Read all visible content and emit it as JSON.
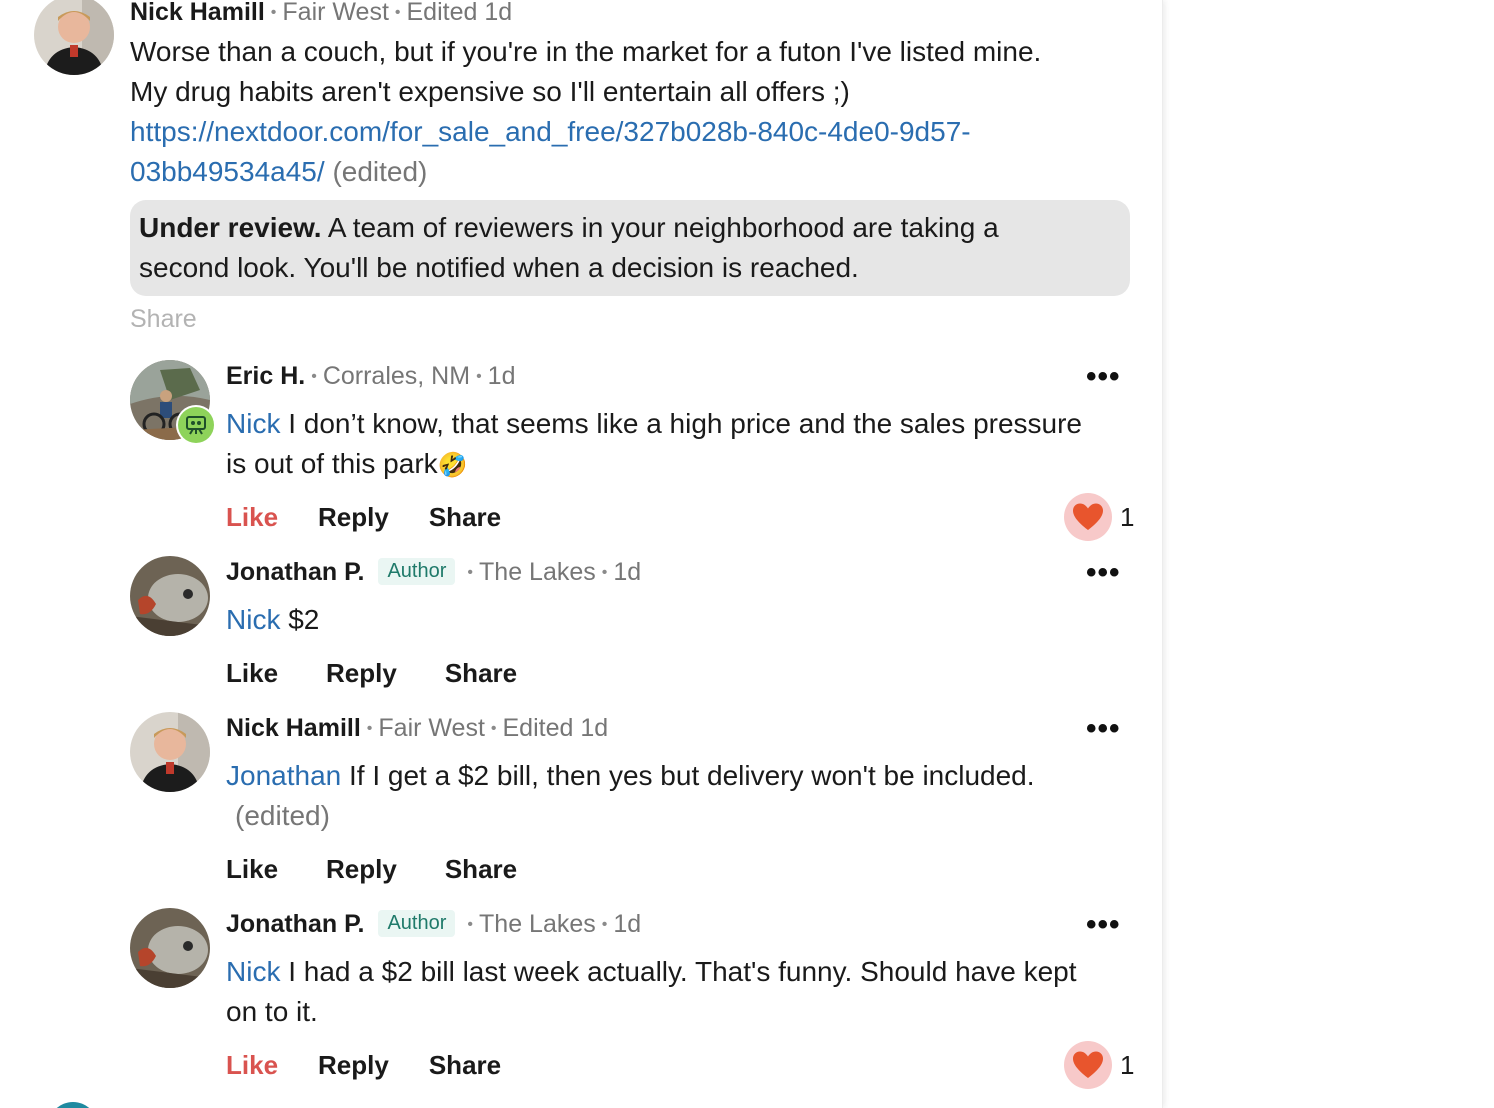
{
  "post": {
    "author": "Nick Hamill",
    "neighborhood": "Fair West",
    "edited_time": "Edited 1d",
    "body_line1": "Worse than a couch, but if you're in the market for a futon I've listed mine.",
    "body_line2": "My drug habits aren't expensive so I'll entertain all offers ;)",
    "link_line1": "https://nextdoor.com/for_sale_and_free/327b028b-840c-4de0-9d57-",
    "link_line2": "03bb49534a45/",
    "edited_tag": "(edited)",
    "review_title": "Under review.",
    "review_line1": " A team of reviewers in your neighborhood are taking a",
    "review_line2": "second look. You'll be notified when a decision is reached.",
    "share_label": "Share"
  },
  "replies": [
    {
      "author": "Eric H.",
      "location": "Corrales, NM",
      "time": "1d",
      "mention": "Nick",
      "text_line1": " I don’t know, that seems like a high price and the sales pressure",
      "text_line2": "is out of this park",
      "emoji": "🤣",
      "like": "Like",
      "reply": "Reply",
      "share": "Share",
      "reaction_count": "1"
    },
    {
      "author": "Jonathan P.",
      "badge": "Author",
      "location": "The Lakes",
      "time": "1d",
      "mention": "Nick",
      "text_line1": " $2",
      "like": "Like",
      "reply": "Reply",
      "share": "Share"
    },
    {
      "author": "Nick Hamill",
      "location": "Fair West",
      "time": "Edited 1d",
      "mention": "Jonathan",
      "text_line1": " If I get a $2 bill, then yes but delivery won't be included.",
      "text_line2": "(edited)",
      "like": "Like",
      "reply": "Reply",
      "share": "Share"
    },
    {
      "author": "Jonathan P.",
      "badge": "Author",
      "location": "The Lakes",
      "time": "1d",
      "mention": "Nick",
      "text_line1": " I had a $2 bill last week actually. That's funny. Should have kept",
      "text_line2": "on to it.",
      "like": "Like",
      "reply": "Reply",
      "share": "Share",
      "reaction_count": "1"
    }
  ],
  "icons": {
    "more": "more-options-icon",
    "heart": "heart-icon",
    "moderator": "neighborhood-reviewer-badge-icon"
  },
  "colors": {
    "link": "#2a6db0",
    "liked": "#d9534f",
    "author_badge": "#1f7a6a",
    "review_bg": "#e6e6e6"
  }
}
